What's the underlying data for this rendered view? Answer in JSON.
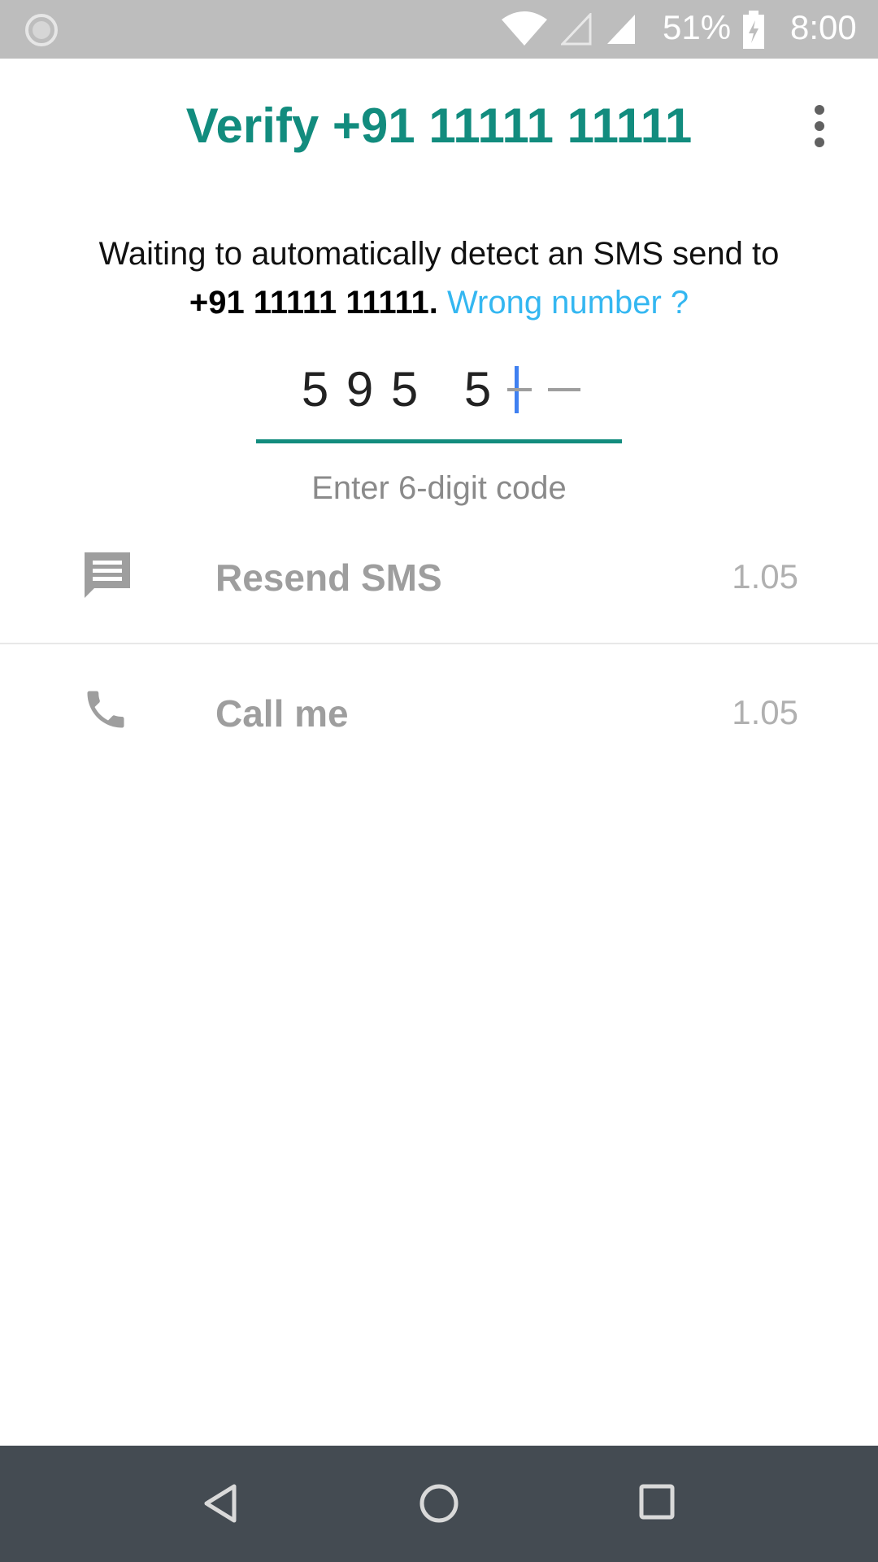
{
  "status_bar": {
    "battery_percent": "51%",
    "time": "8:00",
    "icons": [
      "app-notification-icon",
      "wifi-icon",
      "no-signal-icon",
      "cell-signal-icon",
      "battery-charging-icon"
    ]
  },
  "header": {
    "title": "Verify +91 11111 11111",
    "menu_icon": "more-vert-icon"
  },
  "instructions": {
    "text": "Waiting to automatically detect an SMS send to",
    "phone": "+91 11111 11111.",
    "wrong_number_link": "Wrong number ?"
  },
  "code_input": {
    "entered_digits": [
      "5",
      "9",
      "5",
      "5"
    ],
    "total_digits": 6,
    "hint": "Enter 6-digit code"
  },
  "options": {
    "resend_sms": {
      "label": "Resend SMS",
      "timer": "1.05",
      "icon": "message-icon"
    },
    "call_me": {
      "label": "Call me",
      "timer": "1.05",
      "icon": "phone-icon"
    }
  },
  "nav_bar": {
    "icons": [
      "back-icon",
      "home-icon",
      "recents-icon"
    ]
  },
  "colors": {
    "accent": "#128c7e",
    "link": "#34b7f1",
    "cursor": "#3f80f1",
    "status_bar": "#bdbdbd",
    "nav_bar": "#444b52"
  }
}
